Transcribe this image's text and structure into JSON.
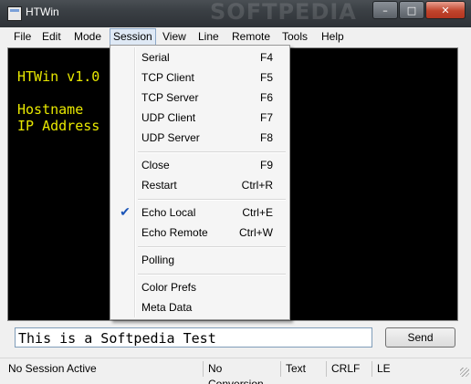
{
  "window": {
    "title": "HTWin",
    "watermark": "SOFTPEDIA"
  },
  "menubar": {
    "items": [
      "File",
      "Edit",
      "Mode",
      "Session",
      "View",
      "Line",
      "Remote",
      "Tools",
      "Help"
    ],
    "active": "Session"
  },
  "terminal": {
    "lines": [
      "HTWin v1.0",
      "",
      "Hostname",
      "IP Address"
    ],
    "text_color": "#e8e800",
    "background": "#000000"
  },
  "session_menu": {
    "items": [
      {
        "label": "Serial",
        "shortcut": "F4"
      },
      {
        "label": "TCP Client",
        "shortcut": "F5"
      },
      {
        "label": "TCP Server",
        "shortcut": "F6"
      },
      {
        "label": "UDP Client",
        "shortcut": "F7"
      },
      {
        "label": "UDP Server",
        "shortcut": "F8"
      },
      {
        "label": "Close",
        "shortcut": "F9"
      },
      {
        "label": "Restart",
        "shortcut": "Ctrl+R"
      },
      {
        "label": "Echo Local",
        "shortcut": "Ctrl+E",
        "checked": true
      },
      {
        "label": "Echo Remote",
        "shortcut": "Ctrl+W"
      },
      {
        "label": "Polling",
        "shortcut": ""
      },
      {
        "label": "Color Prefs",
        "shortcut": ""
      },
      {
        "label": "Meta Data",
        "shortcut": ""
      }
    ]
  },
  "input": {
    "value": "This is a Softpedia Test"
  },
  "send_button": {
    "label": "Send"
  },
  "statusbar": {
    "session": "No Session Active",
    "conversion": "No Conversion",
    "mode": "Text",
    "line_ending": "CRLF",
    "echo": "LE"
  },
  "icons": {
    "check": "checkmark-icon",
    "minimize": "minimize-icon",
    "maximize": "maximize-icon",
    "close": "close-icon"
  }
}
